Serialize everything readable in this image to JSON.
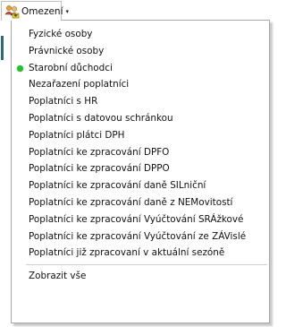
{
  "toolbar": {
    "button_label": "Omezení",
    "arrow_glyph": "▾",
    "icon": "users-filter-icon"
  },
  "menu": {
    "items": [
      {
        "label": "Fyzické osoby",
        "checked": false
      },
      {
        "label": "Právnické osoby",
        "checked": false
      },
      {
        "label": "Starobní důchodci",
        "checked": true
      },
      {
        "label": "Nezařazení poplatníci",
        "checked": false
      },
      {
        "label": "Poplatníci s HR",
        "checked": false
      },
      {
        "label": "Poplatníci s datovou schránkou",
        "checked": false
      },
      {
        "label": "Poplatníci plátci DPH",
        "checked": false
      },
      {
        "label": "Poplatníci ke zpracování DPFO",
        "checked": false
      },
      {
        "label": "Poplatníci ke zpracování DPPO",
        "checked": false
      },
      {
        "label": "Poplatníci ke zpracování daně SILniční",
        "checked": false
      },
      {
        "label": "Poplatníci ke zpracování daně z NEMovitostí",
        "checked": false
      },
      {
        "label": "Poplatníci ke zpracování Vyúčtování SRÁžkové",
        "checked": false
      },
      {
        "label": "Poplatníci ke zpracování Vyúčtování ze ZÁVislé",
        "checked": false
      },
      {
        "label": "Poplatníci již zpracovaní v aktuální sezóně",
        "checked": false
      }
    ],
    "footer_item": {
      "label": "Zobrazit vše"
    },
    "check_color": "#22c32a"
  }
}
